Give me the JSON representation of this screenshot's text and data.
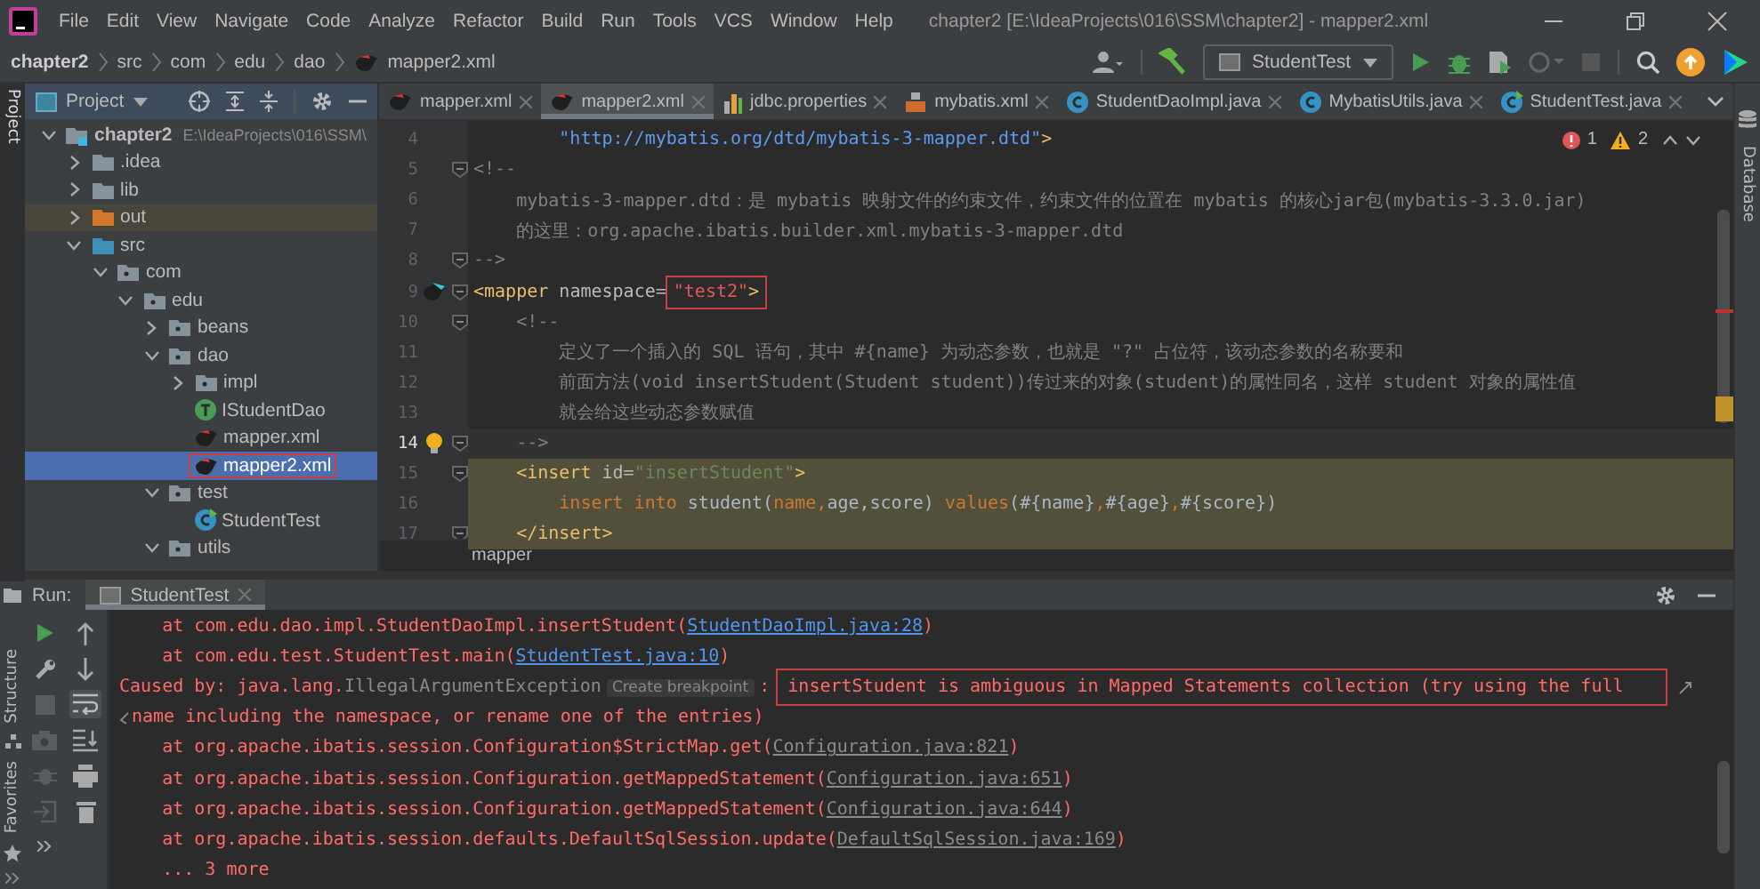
{
  "window": {
    "title": "chapter2 [E:\\IdeaProjects\\016\\SSM\\chapter2] - mapper2.xml"
  },
  "menu": [
    "File",
    "Edit",
    "View",
    "Navigate",
    "Code",
    "Analyze",
    "Refactor",
    "Build",
    "Run",
    "Tools",
    "VCS",
    "Window",
    "Help"
  ],
  "breadcrumbs": [
    {
      "label": "chapter2",
      "kind": "project"
    },
    {
      "label": "src",
      "kind": "folder"
    },
    {
      "label": "com",
      "kind": "folder"
    },
    {
      "label": "edu",
      "kind": "folder"
    },
    {
      "label": "dao",
      "kind": "folder"
    },
    {
      "label": "mapper2.xml",
      "kind": "xml"
    }
  ],
  "run_config": {
    "label": "StudentTest"
  },
  "left_strip_top": [
    {
      "label": "Project",
      "selected": true
    }
  ],
  "left_strip_bottom": [
    {
      "label": "Structure",
      "selected": false
    },
    {
      "label": "Favorites",
      "selected": false
    }
  ],
  "right_strip": [
    {
      "label": "Database"
    }
  ],
  "project_panel": {
    "title": "Project",
    "tree": [
      {
        "label": "chapter2",
        "path": "E:\\IdeaProjects\\016\\SSM\\",
        "kind": "module",
        "expanded": true,
        "selected": false,
        "boxed": false,
        "children": [
          {
            "label": ".idea",
            "kind": "folder",
            "expanded": false,
            "selected": false,
            "boxed": false
          },
          {
            "label": "lib",
            "kind": "folder",
            "expanded": false,
            "selected": false,
            "boxed": false
          },
          {
            "label": "out",
            "kind": "excluded",
            "expanded": false,
            "selected": false,
            "boxed": false
          },
          {
            "label": "src",
            "kind": "source",
            "expanded": true,
            "selected": false,
            "boxed": false,
            "children": [
              {
                "label": "com",
                "kind": "package",
                "expanded": true,
                "selected": false,
                "boxed": false,
                "children": [
                  {
                    "label": "edu",
                    "kind": "package",
                    "expanded": true,
                    "selected": false,
                    "boxed": false,
                    "children": [
                      {
                        "label": "beans",
                        "kind": "package",
                        "expanded": false,
                        "selected": false,
                        "boxed": false
                      },
                      {
                        "label": "dao",
                        "kind": "package",
                        "expanded": true,
                        "selected": false,
                        "boxed": false,
                        "children": [
                          {
                            "label": "impl",
                            "kind": "package",
                            "expanded": false,
                            "selected": false,
                            "boxed": false
                          },
                          {
                            "label": "IStudentDao",
                            "kind": "interface",
                            "selected": false,
                            "boxed": false
                          },
                          {
                            "label": "mapper.xml",
                            "kind": "xml",
                            "selected": false,
                            "boxed": false
                          },
                          {
                            "label": "mapper2.xml",
                            "kind": "xml",
                            "selected": true,
                            "boxed": true
                          }
                        ]
                      },
                      {
                        "label": "test",
                        "kind": "package",
                        "expanded": true,
                        "selected": false,
                        "boxed": false,
                        "children": [
                          {
                            "label": "StudentTest",
                            "kind": "testclass",
                            "selected": false,
                            "boxed": false
                          }
                        ]
                      },
                      {
                        "label": "utils",
                        "kind": "package",
                        "expanded": true,
                        "selected": false,
                        "boxed": false
                      }
                    ]
                  }
                ]
              }
            ]
          }
        ]
      }
    ]
  },
  "editor_tabs": [
    {
      "label": "mapper.xml",
      "kind": "xml",
      "selected": false
    },
    {
      "label": "mapper2.xml",
      "kind": "xml",
      "selected": true
    },
    {
      "label": "jdbc.properties",
      "kind": "properties",
      "selected": false
    },
    {
      "label": "mybatis.xml",
      "kind": "config",
      "selected": false
    },
    {
      "label": "StudentDaoImpl.java",
      "kind": "class",
      "selected": false
    },
    {
      "label": "MybatisUtils.java",
      "kind": "class",
      "selected": false
    },
    {
      "label": "StudentTest.java",
      "kind": "testclass",
      "selected": false
    }
  ],
  "editor": {
    "errors": "1",
    "warnings": "2",
    "breadcrumb": "mapper",
    "lines": [
      {
        "number": "4",
        "fold": false,
        "current": false,
        "highlighted": false,
        "mapper_icon": false,
        "bulb": false,
        "code": [
          {
            "text": "        \"http://mybatis.org/dtd/mybatis-3-mapper.dtd\"",
            "kind": "url",
            "boxed": false
          },
          {
            "text": ">",
            "kind": "tag",
            "boxed": false
          }
        ]
      },
      {
        "number": "5",
        "fold": true,
        "current": false,
        "highlighted": false,
        "mapper_icon": false,
        "bulb": false,
        "code": [
          {
            "text": "<!--",
            "kind": "comment",
            "boxed": false
          }
        ]
      },
      {
        "number": "6",
        "fold": false,
        "current": false,
        "highlighted": false,
        "mapper_icon": false,
        "bulb": false,
        "code": [
          {
            "text": "    mybatis-3-mapper.dtd：是 mybatis 映射文件的约束文件，约束文件的位置在 mybatis 的核心jar包(mybatis-3.3.0.jar)",
            "kind": "comment",
            "boxed": false
          }
        ]
      },
      {
        "number": "7",
        "fold": false,
        "current": false,
        "highlighted": false,
        "mapper_icon": false,
        "bulb": false,
        "code": [
          {
            "text": "    的这里：org.apache.ibatis.builder.xml.mybatis-3-mapper.dtd",
            "kind": "comment",
            "boxed": false
          }
        ]
      },
      {
        "number": "8",
        "fold": true,
        "current": false,
        "highlighted": false,
        "mapper_icon": false,
        "bulb": false,
        "code": [
          {
            "text": "-->",
            "kind": "comment",
            "boxed": false
          }
        ]
      },
      {
        "number": "9",
        "fold": true,
        "current": false,
        "highlighted": false,
        "mapper_icon": true,
        "bulb": false,
        "code": [
          {
            "text": "<mapper ",
            "kind": "tag",
            "boxed": false
          },
          {
            "text": "namespace=",
            "kind": "attr",
            "boxed": false
          },
          {
            "text": "\"test2\"",
            "kind": "error-string",
            "boxed": true
          },
          {
            "text": ">",
            "kind": "tag",
            "boxed": true
          }
        ]
      },
      {
        "number": "10",
        "fold": true,
        "current": false,
        "highlighted": false,
        "mapper_icon": false,
        "bulb": false,
        "code": [
          {
            "text": "    <!--",
            "kind": "comment",
            "boxed": false
          }
        ]
      },
      {
        "number": "11",
        "fold": false,
        "current": false,
        "highlighted": false,
        "mapper_icon": false,
        "bulb": false,
        "code": [
          {
            "text": "        定义了一个插入的 SQL 语句，其中 #{name} 为动态参数，也就是 \"?\" 占位符，该动态参数的名称要和",
            "kind": "comment",
            "boxed": false
          }
        ]
      },
      {
        "number": "12",
        "fold": false,
        "current": false,
        "highlighted": false,
        "mapper_icon": false,
        "bulb": false,
        "code": [
          {
            "text": "        前面方法(void insertStudent(Student student))传过来的对象(student)的属性同名，这样 student 对象的属性值",
            "kind": "comment",
            "boxed": false
          }
        ]
      },
      {
        "number": "13",
        "fold": false,
        "current": false,
        "highlighted": false,
        "mapper_icon": false,
        "bulb": false,
        "code": [
          {
            "text": "        就会给这些动态参数赋值",
            "kind": "comment",
            "boxed": false
          }
        ]
      },
      {
        "number": "14",
        "fold": true,
        "current": true,
        "highlighted": false,
        "mapper_icon": false,
        "bulb": true,
        "code": [
          {
            "text": "    -->",
            "kind": "comment",
            "boxed": false
          }
        ]
      },
      {
        "number": "15",
        "fold": true,
        "current": false,
        "highlighted": true,
        "mapper_icon": false,
        "bulb": false,
        "code": [
          {
            "text": "    <insert ",
            "kind": "tag",
            "boxed": false
          },
          {
            "text": "id=",
            "kind": "attr",
            "boxed": false
          },
          {
            "text": "\"insertStudent\"",
            "kind": "string",
            "boxed": false
          },
          {
            "text": ">",
            "kind": "tag",
            "boxed": false
          }
        ]
      },
      {
        "number": "16",
        "fold": false,
        "current": false,
        "highlighted": true,
        "mapper_icon": false,
        "bulb": false,
        "code": [
          {
            "text": "        insert into",
            "kind": "keyword",
            "boxed": false
          },
          {
            "text": " student(",
            "kind": "plain",
            "boxed": false
          },
          {
            "text": "name,",
            "kind": "keyword",
            "boxed": false
          },
          {
            "text": "age,score) ",
            "kind": "plain",
            "boxed": false
          },
          {
            "text": "values",
            "kind": "keyword",
            "boxed": false
          },
          {
            "text": "(#{name}",
            "kind": "plain",
            "boxed": false
          },
          {
            "text": ",",
            "kind": "keyword",
            "boxed": false
          },
          {
            "text": "#{age}",
            "kind": "plain",
            "boxed": false
          },
          {
            "text": ",",
            "kind": "keyword",
            "boxed": false
          },
          {
            "text": "#{score})",
            "kind": "plain",
            "boxed": false
          }
        ]
      },
      {
        "number": "17",
        "fold": true,
        "current": false,
        "highlighted": true,
        "mapper_icon": false,
        "bulb": false,
        "code": [
          {
            "text": "    </insert>",
            "kind": "tag",
            "boxed": false
          }
        ]
      }
    ]
  },
  "run_panel": {
    "label": "Run:",
    "tabs": [
      {
        "label": "StudentTest",
        "selected": true
      }
    ],
    "toolbar_main": [
      {
        "kind": "run",
        "disabled": false
      },
      {
        "kind": "settings",
        "disabled": false
      },
      {
        "kind": "stop",
        "disabled": true
      },
      {
        "kind": "camera",
        "disabled": true
      },
      {
        "kind": "bug",
        "disabled": true
      },
      {
        "kind": "exit",
        "disabled": true
      },
      {
        "kind": "more",
        "disabled": false
      }
    ],
    "toolbar_side": [
      {
        "kind": "up",
        "selected": false
      },
      {
        "kind": "down",
        "selected": false
      },
      {
        "kind": "wrap",
        "selected": true
      },
      {
        "kind": "scroll-end",
        "selected": false
      },
      {
        "kind": "print",
        "selected": false
      },
      {
        "kind": "trash",
        "selected": false
      }
    ],
    "console": [
      {
        "wrapped": false,
        "segments": [
          {
            "text": "    at com.edu.dao.impl.StudentDaoImpl.insertStudent(",
            "kind": "error"
          },
          {
            "text": "StudentDaoImpl.java:28",
            "kind": "link"
          },
          {
            "text": ")",
            "kind": "error"
          }
        ]
      },
      {
        "wrapped": false,
        "segments": [
          {
            "text": "    at com.edu.test.StudentTest.main(",
            "kind": "error"
          },
          {
            "text": "StudentTest.java:10",
            "kind": "link"
          },
          {
            "text": ")",
            "kind": "error"
          }
        ]
      },
      {
        "wrapped": true,
        "segments": [
          {
            "text": "Caused by: java.lang.",
            "kind": "error"
          },
          {
            "text": "IllegalArgumentException",
            "kind": "class"
          },
          {
            "text": "Create breakpoint",
            "kind": "hint"
          },
          {
            "text": ":",
            "kind": "error"
          },
          {
            "text": "insertStudent is ambiguous in Mapped Statements collection (try using the full",
            "kind": "boxed"
          }
        ]
      },
      {
        "wrapped": false,
        "segments": [
          {
            "text": "name including the namespace, or rename one of the entries)",
            "kind": "error"
          }
        ]
      },
      {
        "wrapped": false,
        "segments": [
          {
            "text": "    at org.apache.ibatis.session.Configuration$StrictMap.get(",
            "kind": "error"
          },
          {
            "text": "Configuration.java:821",
            "kind": "muted-link"
          },
          {
            "text": ")",
            "kind": "error"
          }
        ]
      },
      {
        "wrapped": false,
        "segments": [
          {
            "text": "    at org.apache.ibatis.session.Configuration.getMappedStatement(",
            "kind": "error"
          },
          {
            "text": "Configuration.java:651",
            "kind": "muted-link"
          },
          {
            "text": ")",
            "kind": "error"
          }
        ]
      },
      {
        "wrapped": false,
        "segments": [
          {
            "text": "    at org.apache.ibatis.session.Configuration.getMappedStatement(",
            "kind": "error"
          },
          {
            "text": "Configuration.java:644",
            "kind": "muted-link"
          },
          {
            "text": ")",
            "kind": "error"
          }
        ]
      },
      {
        "wrapped": false,
        "segments": [
          {
            "text": "    at org.apache.ibatis.session.defaults.DefaultSqlSession.update(",
            "kind": "error"
          },
          {
            "text": "DefaultSqlSession.java:169",
            "kind": "muted-link"
          },
          {
            "text": ")",
            "kind": "error"
          }
        ]
      },
      {
        "wrapped": false,
        "segments": [
          {
            "text": "    ... 3 more",
            "kind": "error"
          }
        ]
      }
    ]
  }
}
